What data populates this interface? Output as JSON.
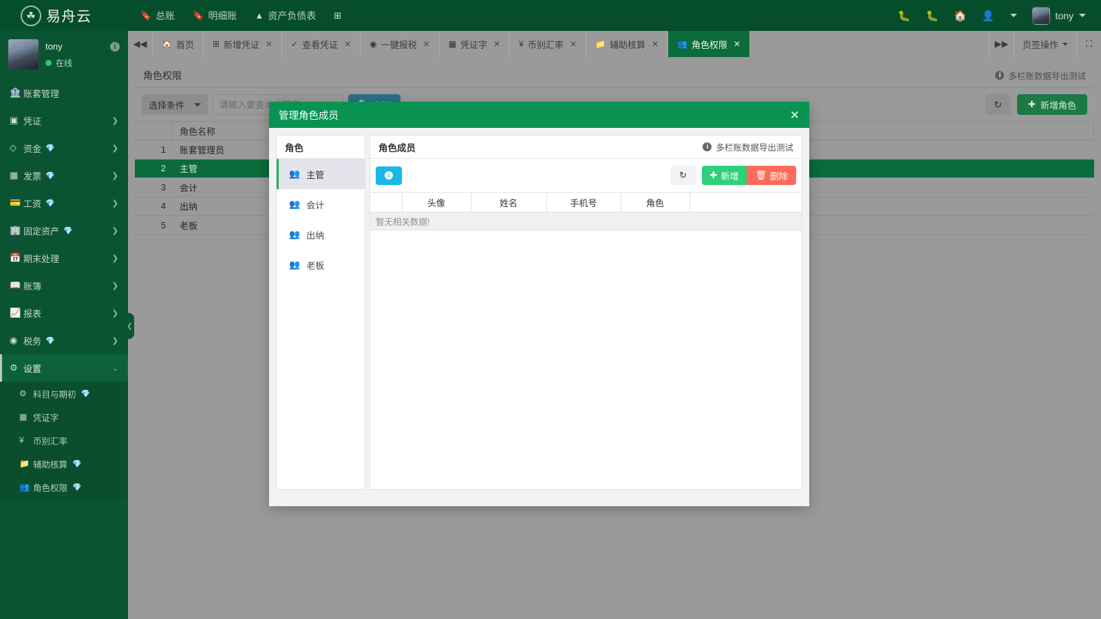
{
  "topbar": {
    "brand": {
      "logo_icon": "seal-logo-icon",
      "name": "易舟云"
    },
    "nav": [
      {
        "icon": "book-icon",
        "label": "总账"
      },
      {
        "icon": "book-icon",
        "label": "明细账"
      },
      {
        "icon": "chart-icon",
        "label": "资产负债表"
      },
      {
        "icon": "add-grid-icon",
        "label": ""
      }
    ],
    "right_icons": [
      "bug-icon",
      "bug-icon",
      "home-icon",
      "user-switch-icon"
    ],
    "user": {
      "name": "tony",
      "avatar": "user-avatar"
    }
  },
  "sidebar": {
    "user": {
      "name": "tony",
      "status": "在线",
      "info_icon": "info-icon"
    },
    "items": [
      {
        "icon": "archive-icon",
        "label": "账套管理",
        "vip": false,
        "arrow": false
      },
      {
        "icon": "voucher-icon",
        "label": "凭证",
        "vip": false,
        "arrow": true
      },
      {
        "icon": "funds-icon",
        "label": "资金",
        "vip": true,
        "arrow": true
      },
      {
        "icon": "invoice-icon",
        "label": "发票",
        "vip": true,
        "arrow": true
      },
      {
        "icon": "salary-icon",
        "label": "工资",
        "vip": true,
        "arrow": true
      },
      {
        "icon": "asset-icon",
        "label": "固定资产",
        "vip": true,
        "arrow": true
      },
      {
        "icon": "calendar-icon",
        "label": "期末处理",
        "vip": false,
        "arrow": true
      },
      {
        "icon": "ledger-icon",
        "label": "账簿",
        "vip": false,
        "arrow": true
      },
      {
        "icon": "report-icon",
        "label": "报表",
        "vip": false,
        "arrow": true
      },
      {
        "icon": "tax-icon",
        "label": "税务",
        "vip": true,
        "arrow": true
      },
      {
        "icon": "gear-icon",
        "label": "设置",
        "vip": false,
        "arrow": true,
        "active": true
      }
    ],
    "submenu": [
      {
        "icon": "subject-icon",
        "label": "科目与期初",
        "vip": true
      },
      {
        "icon": "voucher-word-icon",
        "label": "凭证字",
        "vip": false
      },
      {
        "icon": "yen-icon",
        "label": "币别汇率",
        "vip": false
      },
      {
        "icon": "folder-icon",
        "label": "辅助核算",
        "vip": true
      },
      {
        "icon": "users-icon",
        "label": "角色权限",
        "vip": true
      }
    ],
    "collapse_icon": "chevron-left-icon"
  },
  "tabbar": {
    "prev_icon": "double-left-icon",
    "next_icon": "double-right-icon",
    "tabs": [
      {
        "icon": "home-icon",
        "label": "首页",
        "closable": false,
        "active": false
      },
      {
        "icon": "plus-square-icon",
        "label": "新增凭证",
        "closable": true,
        "active": false
      },
      {
        "icon": "check-circle-icon",
        "label": "查看凭证",
        "closable": true,
        "active": false
      },
      {
        "icon": "tax-icon",
        "label": "一键报税",
        "closable": true,
        "active": false
      },
      {
        "icon": "voucher-word-icon",
        "label": "凭证字",
        "closable": true,
        "active": false
      },
      {
        "icon": "yen-icon",
        "label": "币别汇率",
        "closable": true,
        "active": false
      },
      {
        "icon": "folder-icon",
        "label": "辅助核算",
        "closable": true,
        "active": false
      },
      {
        "icon": "users-icon",
        "label": "角色权限",
        "closable": true,
        "active": true
      }
    ],
    "ops_label": "页签操作",
    "fullscreen_icon": "collapse-icon"
  },
  "page": {
    "title": "角色权限",
    "export_test_label": "多栏账数据导出测试",
    "toolbar": {
      "condition_select": "选择条件",
      "search_placeholder": "请输入要查询关键字",
      "search_value": "",
      "search_button": "查询",
      "refresh_icon": "refresh-icon",
      "add_role_button": "新增角色"
    },
    "grid": {
      "columns": [
        "",
        "角色名称"
      ],
      "rows": [
        {
          "idx": "1",
          "name": "账套管理员",
          "selected": false
        },
        {
          "idx": "2",
          "name": "主管",
          "selected": true
        },
        {
          "idx": "3",
          "name": "会计",
          "selected": false
        },
        {
          "idx": "4",
          "name": "出纳",
          "selected": false
        },
        {
          "idx": "5",
          "name": "老板",
          "selected": false
        }
      ]
    }
  },
  "modal": {
    "title": "管理角色成员",
    "close_icon": "close-icon",
    "left": {
      "header": "角色",
      "roles": [
        {
          "icon": "users-icon",
          "label": "主管",
          "active": true
        },
        {
          "icon": "users-icon",
          "label": "会计",
          "active": false
        },
        {
          "icon": "users-icon",
          "label": "出纳",
          "active": false
        },
        {
          "icon": "users-icon",
          "label": "老板",
          "active": false
        }
      ]
    },
    "right": {
      "header": "角色成员",
      "export_test_label": "多栏账数据导出测试",
      "info_button_icon": "info-icon",
      "refresh_icon": "refresh-icon",
      "new_button": "新增",
      "delete_button": "删除",
      "columns": [
        "",
        "头像",
        "姓名",
        "手机号",
        "角色",
        ""
      ],
      "rows": [],
      "empty_text": "暂无相关数据!"
    }
  },
  "colors": {
    "brand_green": "#064d2b",
    "sidebar_green": "#0b5431",
    "modal_header_green": "#089450",
    "accent_new": "#2fd07a",
    "accent_delete": "#fb6a5a",
    "accent_info": "#18b8e9",
    "selected_row": "#0b6b3a",
    "page_gray": "#9a9a9a"
  }
}
